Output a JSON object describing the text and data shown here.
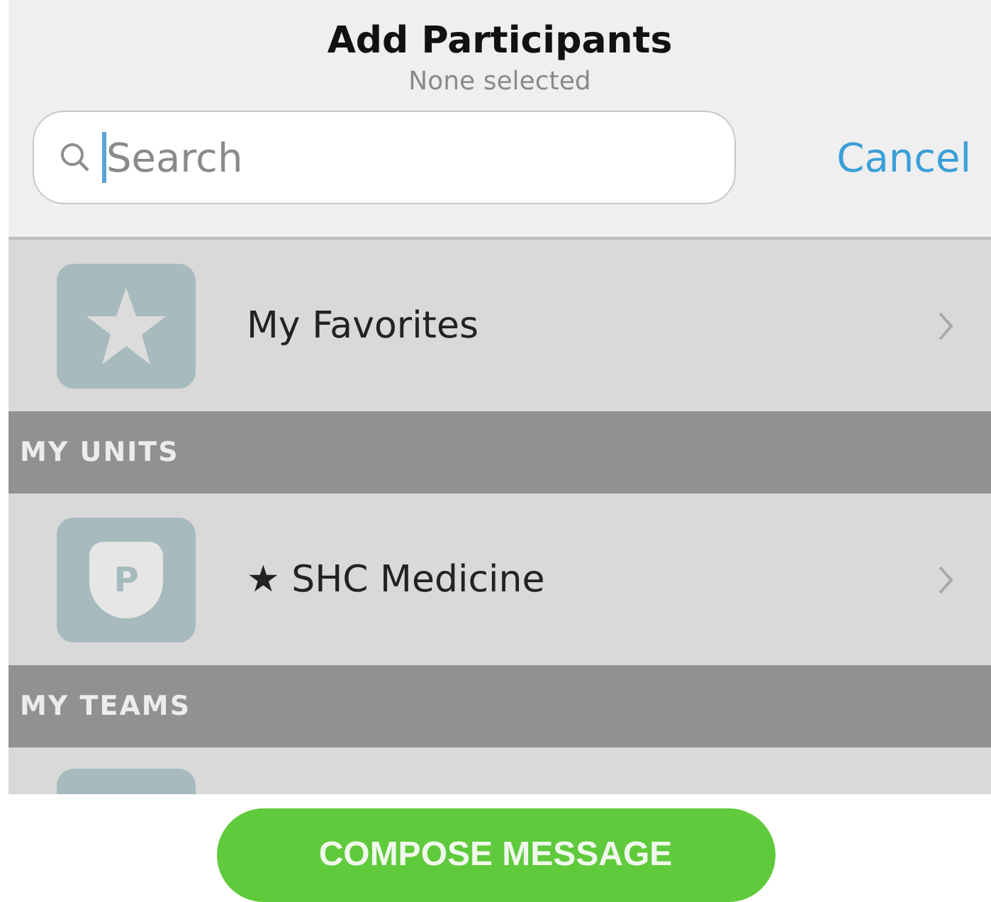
{
  "header": {
    "title": "Add Participants",
    "subtitle": "None selected"
  },
  "search": {
    "placeholder": "Search",
    "focused": true
  },
  "cancel": "Cancel",
  "sections": [
    {
      "items": [
        {
          "kind": "favorites",
          "label": "My Favorites"
        }
      ]
    },
    {
      "heading": "MY UNITS",
      "items": [
        {
          "kind": "unit",
          "badge_letter": "P",
          "label": "★ SHC Medicine"
        }
      ]
    },
    {
      "heading": "MY TEAMS",
      "items": [
        {
          "kind": "team"
        }
      ]
    }
  ],
  "compose_button": "COMPOSE MESSAGE"
}
